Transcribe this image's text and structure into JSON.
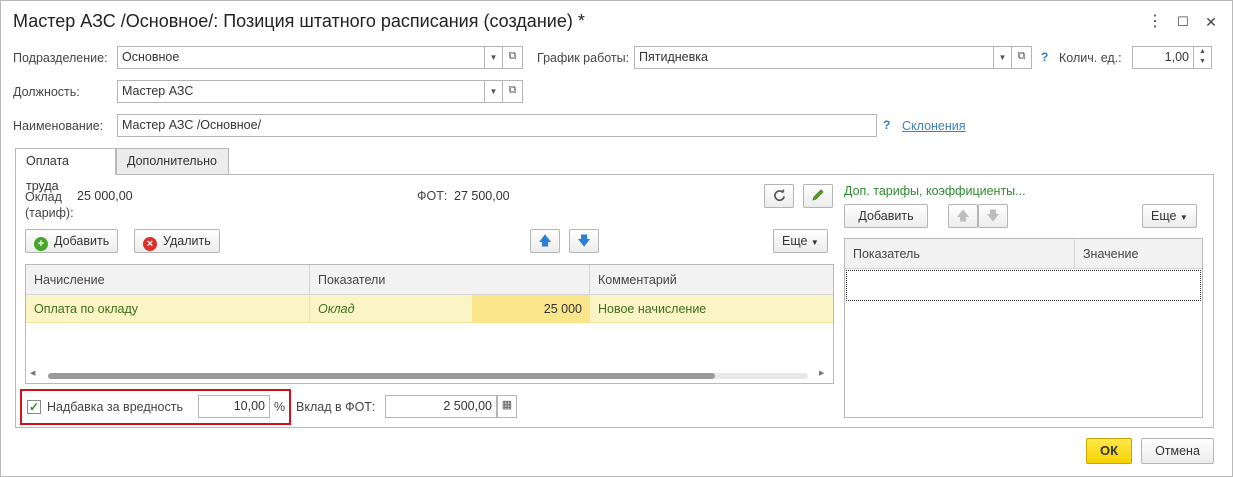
{
  "window": {
    "title": "Мастер АЗС /Основное/: Позиция штатного расписания (создание) *",
    "more_icon": "⋮",
    "maximize_icon": "☐",
    "close_icon": "✕"
  },
  "header": {
    "subdivision_label": "Подразделение:",
    "subdivision_value": "Основное",
    "schedule_label": "График работы:",
    "schedule_value": "Пятидневка",
    "units_label": "Колич. ед.:",
    "units_value": "1,00",
    "position_label": "Должность:",
    "position_value": "Мастер АЗС",
    "name_label": "Наименование:",
    "name_value": "Мастер АЗС /Основное/",
    "help_mark": "?",
    "declension_link": "Склонения"
  },
  "tabs": [
    {
      "label": "Оплата труда",
      "active": true
    },
    {
      "label": "Дополнительно",
      "active": false
    }
  ],
  "pay": {
    "salary_label_line1": "Оклад",
    "salary_label_line2": "(тариф):",
    "salary_value": "25 000,00",
    "fot_label": "ФОТ:",
    "fot_value": "27 500,00",
    "add_button": "Добавить",
    "delete_button": "Удалить",
    "more_button": "Еще",
    "columns": [
      "Начисление",
      "Показатели",
      "Комментарий"
    ],
    "rows": [
      {
        "accrual": "Оплата по окладу",
        "indicator": "Оклад",
        "amount": "25 000",
        "comment": "Новое начисление"
      }
    ],
    "hazard_checkbox_checked": true,
    "hazard_label": "Надбавка за вредность",
    "hazard_value": "10,00",
    "percent_sign": "%",
    "contribution_label": "Вклад в ФОТ:",
    "contribution_value": "2 500,00"
  },
  "extra": {
    "title": "Доп. тарифы, коэффициенты...",
    "add_button": "Добавить",
    "more_button": "Еще",
    "columns": [
      "Показатель",
      "Значение"
    ]
  },
  "footer": {
    "ok_button": "ОК",
    "cancel_button": "Отмена"
  },
  "colors": {
    "accent_green": "#2e8b2e",
    "highlight_red": "#d0121b",
    "row_selected": "#fbf4c4",
    "ok_yellow": "#f5d300"
  }
}
